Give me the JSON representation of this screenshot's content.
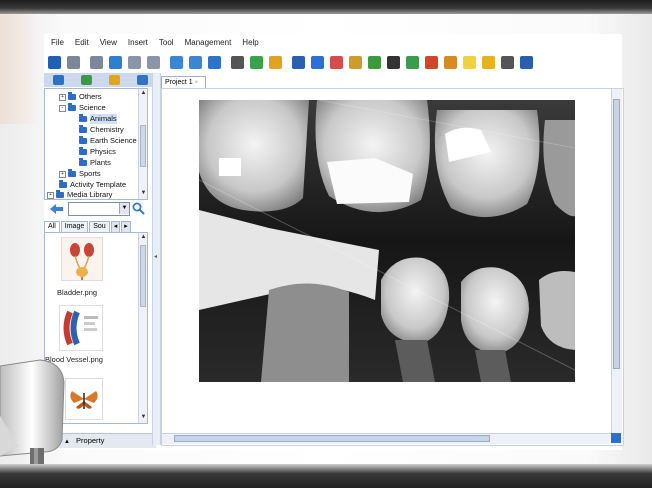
{
  "menu": {
    "items": [
      "File",
      "Edit",
      "View",
      "Insert",
      "Tool",
      "Management",
      "Help"
    ]
  },
  "toolbar": {
    "icons": [
      {
        "name": "screen-icon",
        "color": "#1f5fb4"
      },
      {
        "name": "undo-icon",
        "color": "#7a8899"
      },
      {
        "name": "redo-icon",
        "color": "#7a8899"
      },
      {
        "name": "page-icon",
        "color": "#2f7fd0"
      },
      {
        "name": "prev-icon",
        "color": "#8a96a8"
      },
      {
        "name": "next-icon",
        "color": "#8a96a8"
      },
      {
        "name": "zoom-in-icon",
        "color": "#3a86d4"
      },
      {
        "name": "zoom-out-icon",
        "color": "#3a86d4"
      },
      {
        "name": "hand-icon",
        "color": "#2b74c9"
      },
      {
        "name": "document-icon",
        "color": "#555555"
      },
      {
        "name": "image-icon",
        "color": "#3aa34a"
      },
      {
        "name": "star-icon",
        "color": "#e0a21f"
      },
      {
        "name": "select-arrow-icon",
        "color": "#2a5fb0"
      },
      {
        "name": "pen-icon",
        "color": "#2c6fd6"
      },
      {
        "name": "eraser-icon",
        "color": "#d44c4c"
      },
      {
        "name": "shapes-icon",
        "color": "#cf9b2b"
      },
      {
        "name": "highlighter-icon",
        "color": "#3c9a3c"
      },
      {
        "name": "line-icon",
        "color": "#333333"
      },
      {
        "name": "text-icon",
        "color": "#3b9b4f"
      },
      {
        "name": "fill-icon",
        "color": "#d1462a"
      },
      {
        "name": "brush-icon",
        "color": "#d58b1f"
      },
      {
        "name": "clear-icon",
        "color": "#f2d23c"
      },
      {
        "name": "screen-capture-icon",
        "color": "#e8b21c"
      },
      {
        "name": "printer-icon",
        "color": "#555555"
      },
      {
        "name": "more-icon",
        "color": "#2a5fb0"
      }
    ]
  },
  "tree": {
    "items": [
      {
        "label": "Others",
        "level": 1,
        "expander": "+"
      },
      {
        "label": "Science",
        "level": 1,
        "expander": "-"
      },
      {
        "label": "Animals",
        "level": 2,
        "selected": true
      },
      {
        "label": "Chemistry",
        "level": 2
      },
      {
        "label": "Earth Science",
        "level": 2
      },
      {
        "label": "Physics",
        "level": 2
      },
      {
        "label": "Plants",
        "level": 2
      },
      {
        "label": "Sports",
        "level": 1,
        "expander": "+"
      },
      {
        "label": "Activity Template",
        "level": 0
      },
      {
        "label": "Media Library",
        "level": 0,
        "expander": "+"
      }
    ]
  },
  "search": {
    "placeholder": ""
  },
  "media_tabs": [
    "All",
    "Image",
    "Sou"
  ],
  "media": {
    "items": [
      {
        "caption": "Bladder.png"
      },
      {
        "caption": "Blood Vessel.png"
      },
      {
        "caption": ""
      }
    ]
  },
  "property": {
    "label": "Property"
  },
  "document": {
    "tab_label": "Project 1"
  },
  "colors": {
    "selection": "#cfe0f7",
    "scroll_accent": "#2e6dd0",
    "panel_header": "#ccd9ec"
  }
}
